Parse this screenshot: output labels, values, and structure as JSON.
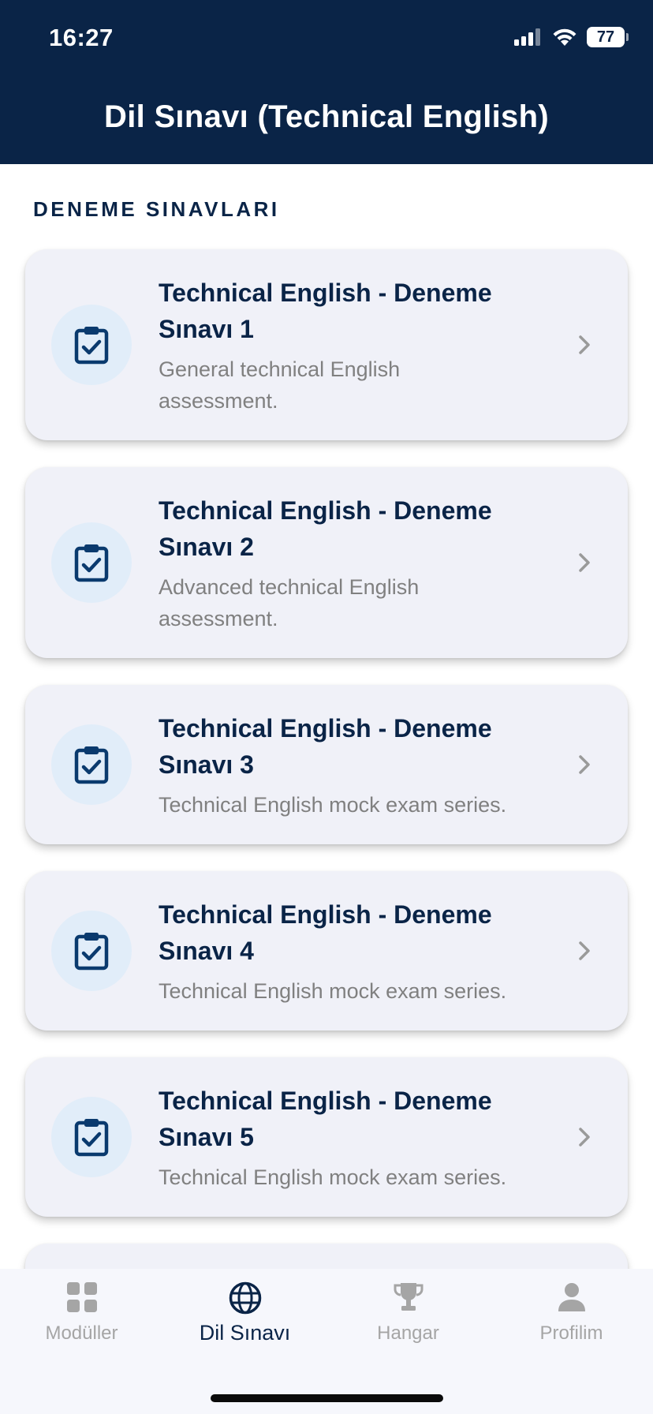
{
  "status_bar": {
    "time": "16:27",
    "battery": "77"
  },
  "header": {
    "title": "Dil Sınavı (Technical English)"
  },
  "section": {
    "label": "DENEME SINAVLARI"
  },
  "cards": [
    {
      "title_line1": "Technical English - Deneme",
      "title_line2": "Sınavı 1",
      "desc_line1": "General technical English",
      "desc_line2": "assessment."
    },
    {
      "title_line1": "Technical English - Deneme",
      "title_line2": "Sınavı 2",
      "desc_line1": "Advanced technical English",
      "desc_line2": "assessment."
    },
    {
      "title_line1": "Technical English - Deneme",
      "title_line2": "Sınavı 3",
      "desc_line1": "Technical English mock exam series.",
      "desc_line2": ""
    },
    {
      "title_line1": "Technical English - Deneme",
      "title_line2": "Sınavı 4",
      "desc_line1": "Technical English mock exam series.",
      "desc_line2": ""
    },
    {
      "title_line1": "Technical English - Deneme",
      "title_line2": "Sınavı 5",
      "desc_line1": "Technical English mock exam series.",
      "desc_line2": ""
    }
  ],
  "tabs": [
    {
      "label": "Modüller",
      "icon": "grid-icon",
      "active": false
    },
    {
      "label": "Dil Sınavı",
      "icon": "globe-icon",
      "active": true
    },
    {
      "label": "Hangar",
      "icon": "trophy-icon",
      "active": false
    },
    {
      "label": "Profilim",
      "icon": "person-icon",
      "active": false
    }
  ],
  "colors": {
    "header_bg": "#0a2447",
    "card_bg": "#f0f1f8",
    "icon_circle": "#e1edf9",
    "inactive_tab": "#a5a5a5"
  }
}
